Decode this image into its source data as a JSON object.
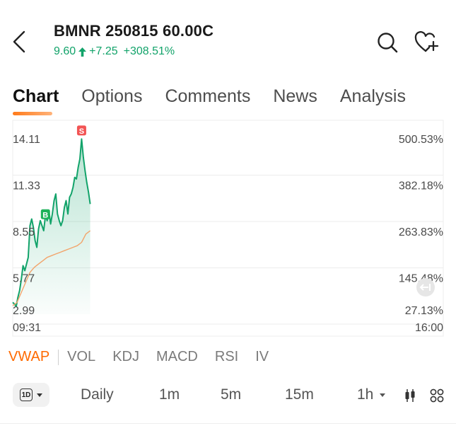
{
  "header": {
    "title": "BMNR 250815 60.00C",
    "price": "9.60",
    "change": "+7.25",
    "change_pct": "+308.51%",
    "up_color": "#12a36a"
  },
  "tabs": [
    {
      "label": "Chart",
      "active": true
    },
    {
      "label": "Options"
    },
    {
      "label": "Comments"
    },
    {
      "label": "News"
    },
    {
      "label": "Analysis"
    }
  ],
  "chart_data": {
    "type": "line",
    "y_left_ticks": [
      "14.11",
      "11.33",
      "8.55",
      "5.77",
      "2.99"
    ],
    "y_right_ticks": [
      "500.53%",
      "382.18%",
      "263.83%",
      "145.48%",
      "27.13%"
    ],
    "ylim": [
      2.99,
      14.11
    ],
    "x_ticks": [
      "09:31",
      "16:00"
    ],
    "time_fraction_range": [
      0,
      0.18
    ],
    "series": [
      {
        "color": "#12a36a",
        "fill": true,
        "points": [
          [
            0,
            3.7
          ],
          [
            0.004,
            3.6
          ],
          [
            0.008,
            3.45
          ],
          [
            0.012,
            4.0
          ],
          [
            0.016,
            4.4
          ],
          [
            0.02,
            5.1
          ],
          [
            0.024,
            5.9
          ],
          [
            0.028,
            5.6
          ],
          [
            0.032,
            6.0
          ],
          [
            0.036,
            6.4
          ],
          [
            0.04,
            8.3
          ],
          [
            0.044,
            8.7
          ],
          [
            0.048,
            8.2
          ],
          [
            0.052,
            7.4
          ],
          [
            0.056,
            7.0
          ],
          [
            0.06,
            8.1
          ],
          [
            0.064,
            8.6
          ],
          [
            0.068,
            8.3
          ],
          [
            0.072,
            8.0
          ],
          [
            0.076,
            8.9
          ],
          [
            0.08,
            8.6
          ],
          [
            0.084,
            9.2
          ],
          [
            0.088,
            8.4
          ],
          [
            0.092,
            9.0
          ],
          [
            0.096,
            9.8
          ],
          [
            0.1,
            10.2
          ],
          [
            0.104,
            9.0
          ],
          [
            0.108,
            8.6
          ],
          [
            0.112,
            8.3
          ],
          [
            0.116,
            8.6
          ],
          [
            0.12,
            9.4
          ],
          [
            0.124,
            9.8
          ],
          [
            0.128,
            9.0
          ],
          [
            0.132,
            10.0
          ],
          [
            0.136,
            10.2
          ],
          [
            0.14,
            10.6
          ],
          [
            0.144,
            11.2
          ],
          [
            0.148,
            11.1
          ],
          [
            0.152,
            11.8
          ],
          [
            0.156,
            12.3
          ],
          [
            0.16,
            13.5
          ],
          [
            0.164,
            12.4
          ],
          [
            0.168,
            11.6
          ],
          [
            0.172,
            10.9
          ],
          [
            0.176,
            10.3
          ],
          [
            0.18,
            9.6
          ]
        ]
      },
      {
        "name": "VWAP",
        "color": "#f2a46b",
        "points": [
          [
            0,
            3.5
          ],
          [
            0.01,
            3.7
          ],
          [
            0.02,
            4.3
          ],
          [
            0.03,
            4.9
          ],
          [
            0.04,
            5.5
          ],
          [
            0.05,
            5.8
          ],
          [
            0.06,
            6.0
          ],
          [
            0.07,
            6.2
          ],
          [
            0.08,
            6.4
          ],
          [
            0.09,
            6.5
          ],
          [
            0.1,
            6.6
          ],
          [
            0.11,
            6.7
          ],
          [
            0.12,
            6.8
          ],
          [
            0.13,
            6.9
          ],
          [
            0.14,
            7.0
          ],
          [
            0.15,
            7.1
          ],
          [
            0.16,
            7.3
          ],
          [
            0.17,
            7.8
          ],
          [
            0.18,
            8.0
          ]
        ]
      }
    ],
    "markers": [
      {
        "label": "S",
        "x": 0.16,
        "y": 13.5,
        "color": "#f25454"
      },
      {
        "label": "B",
        "x": 0.076,
        "y": 8.9,
        "color": "#1fb25a"
      }
    ]
  },
  "indicators": [
    "VWAP",
    "VOL",
    "KDJ",
    "MACD",
    "RSI",
    "IV"
  ],
  "active_indicator": "VWAP",
  "period": {
    "selector_icon": "1D",
    "options": [
      "Daily",
      "1m",
      "5m",
      "15m",
      "1h"
    ],
    "icons": [
      "candlestick-icon",
      "grid-icon"
    ]
  }
}
